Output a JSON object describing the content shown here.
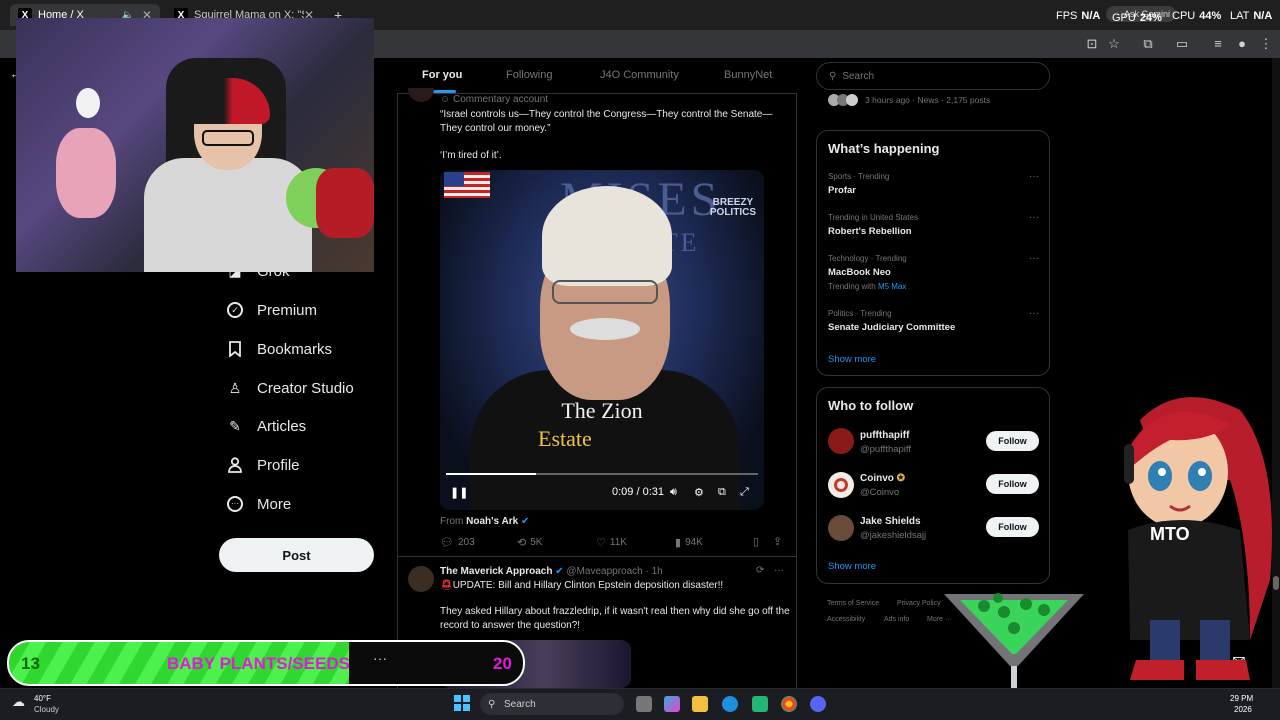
{
  "browser": {
    "tabs": [
      {
        "label": "Home / X",
        "icon": "X"
      },
      {
        "label": "Squirrel Mama on X: \"She alwa",
        "icon": "X"
      }
    ],
    "new_tab": "+"
  },
  "hud": {
    "fps_label": "FPS",
    "fps_value": "N/A",
    "gpu_label": "GPU",
    "gpu_value": "24%",
    "cpu_label": "CPU",
    "cpu_value": "44%",
    "lat_label": "LAT",
    "lat_value": "N/A",
    "gemini": "Ask Gemini"
  },
  "nav": {
    "items": [
      {
        "label": "Grok",
        "icon": "grok-icon"
      },
      {
        "label": "Premium",
        "icon": "premium-icon"
      },
      {
        "label": "Bookmarks",
        "icon": "bookmark-icon"
      },
      {
        "label": "Creator Studio",
        "icon": "creator-studio-icon"
      },
      {
        "label": "Articles",
        "icon": "articles-icon"
      },
      {
        "label": "Profile",
        "icon": "profile-icon"
      },
      {
        "label": "More",
        "icon": "more-icon"
      }
    ],
    "post_button": "Post"
  },
  "feed": {
    "tabs": [
      "For you",
      "Following",
      "J4O Community",
      "BunnyNet"
    ],
    "post1": {
      "label": "Commentary account",
      "text1": "“Israel controls us—They control the Congress—They control the Senate—They control our money.”",
      "text2": "‘I’m tired of it’.",
      "video": {
        "bg_text1": "MISES",
        "bg_text2": "UTE",
        "logo": "BREEZY\nPOLITICS",
        "caption1": "The Zion",
        "caption2": "Estate",
        "time": "0:09 / 0:31",
        "progress": 0.29
      },
      "from_label": "From",
      "from_name": "Noah's Ark",
      "actions": {
        "replies": "203",
        "reposts": "5K",
        "likes": "11K",
        "views": "94K"
      }
    },
    "post2": {
      "name": "The Maverick Approach",
      "handle": "@Maveapproach",
      "time": "· 1h",
      "text1": "UPDATE: Bill and Hillary Clinton Epstein deposition disaster!!",
      "text2": "They asked Hillary about frazzledrip, if it wasn't real then why did she go off the record to answer the question?!"
    }
  },
  "right": {
    "search_placeholder": "Search",
    "top_meta": "3 hours ago · News · 2,175 posts",
    "happening": {
      "title": "What’s happening",
      "items": [
        {
          "meta": "Sports · Trending",
          "title": "Profar",
          "extra": ""
        },
        {
          "meta": "Trending in United States",
          "title": "Robert's Rebellion",
          "extra": ""
        },
        {
          "meta": "Technology · Trending",
          "title": "MacBook Neo",
          "extra_prefix": "Trending with",
          "extra": "M5 Max"
        },
        {
          "meta": "Politics · Trending",
          "title": "Senate Judiciary Committee",
          "extra": ""
        }
      ],
      "show_more": "Show more"
    },
    "who_to_follow": {
      "title": "Who to follow",
      "users": [
        {
          "name": "puffthapiff",
          "handle": "@puffthapiff",
          "button": "Follow"
        },
        {
          "name": "Coinvo",
          "handle": "@Coinvo",
          "button": "Follow"
        },
        {
          "name": "Jake Shields",
          "handle": "@jakeshieldsajj",
          "button": "Follow"
        }
      ],
      "show_more": "Show more"
    },
    "footer": [
      "Terms of Service",
      "Privacy Policy",
      "Accessibility",
      "Ads info",
      "More ···"
    ]
  },
  "overlay": {
    "goal_current": "13",
    "goal_label": "BABY PLANTS/SEEDS",
    "goal_target": "20",
    "goal_menu": "···",
    "avatar_shirt": "MTO"
  },
  "taskbar": {
    "weather_temp": "40°F",
    "weather_desc": "Cloudy",
    "search": "Search",
    "clock_time": "29 PM",
    "clock_year": "2026"
  },
  "colors": {
    "accent": "#1d9bf0",
    "bg": "#000000",
    "goal_green": "#4ef04e",
    "goal_magenta": "#e21bd8"
  }
}
